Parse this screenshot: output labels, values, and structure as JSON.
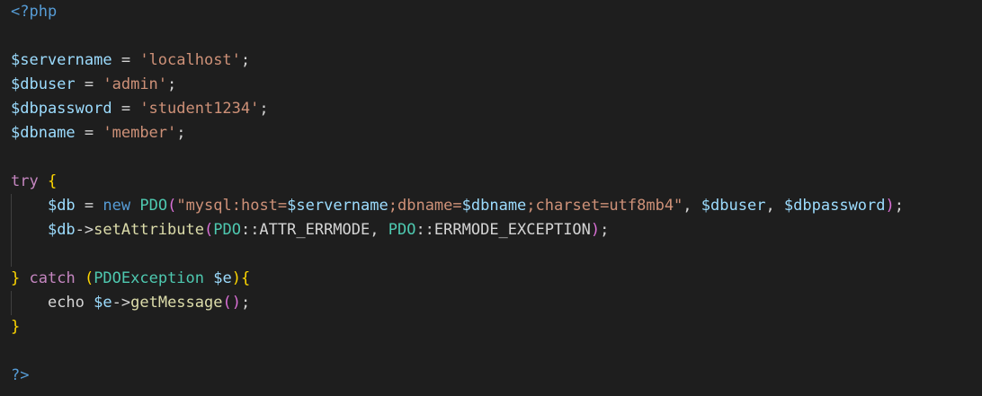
{
  "colors": {
    "background": "#1e1e1e",
    "default": "#d4d4d4",
    "php_tag": "#569cd6",
    "variable": "#9cdcfe",
    "string": "#ce9178",
    "keyword": "#c586c0",
    "storage": "#569cd6",
    "class": "#4ec9b0",
    "function": "#dcdcaa",
    "bracket_gold": "#ffd700",
    "bracket_purple": "#da70d6",
    "bracket_blue": "#179fff"
  },
  "lines": [
    {
      "indent": 0,
      "guide": false,
      "tokens": [
        {
          "t": "<?php",
          "c": "php_tag"
        }
      ]
    },
    {
      "indent": 0,
      "guide": false,
      "tokens": []
    },
    {
      "indent": 0,
      "guide": false,
      "tokens": [
        {
          "t": "$servername",
          "c": "variable"
        },
        {
          "t": " = ",
          "c": "default"
        },
        {
          "t": "'localhost'",
          "c": "string"
        },
        {
          "t": ";",
          "c": "default"
        }
      ]
    },
    {
      "indent": 0,
      "guide": false,
      "tokens": [
        {
          "t": "$dbuser",
          "c": "variable"
        },
        {
          "t": " = ",
          "c": "default"
        },
        {
          "t": "'admin'",
          "c": "string"
        },
        {
          "t": ";",
          "c": "default"
        }
      ]
    },
    {
      "indent": 0,
      "guide": false,
      "tokens": [
        {
          "t": "$dbpassword",
          "c": "variable"
        },
        {
          "t": " = ",
          "c": "default"
        },
        {
          "t": "'student1234'",
          "c": "string"
        },
        {
          "t": ";",
          "c": "default"
        }
      ]
    },
    {
      "indent": 0,
      "guide": false,
      "tokens": [
        {
          "t": "$dbname",
          "c": "variable"
        },
        {
          "t": " = ",
          "c": "default"
        },
        {
          "t": "'member'",
          "c": "string"
        },
        {
          "t": ";",
          "c": "default"
        }
      ]
    },
    {
      "indent": 0,
      "guide": false,
      "tokens": []
    },
    {
      "indent": 0,
      "guide": false,
      "tokens": [
        {
          "t": "try",
          "c": "keyword"
        },
        {
          "t": " ",
          "c": "default"
        },
        {
          "t": "{",
          "c": "bracket_gold"
        }
      ]
    },
    {
      "indent": 4,
      "guide": true,
      "tokens": [
        {
          "t": "$db",
          "c": "variable"
        },
        {
          "t": " = ",
          "c": "default"
        },
        {
          "t": "new",
          "c": "storage"
        },
        {
          "t": " ",
          "c": "default"
        },
        {
          "t": "PDO",
          "c": "class"
        },
        {
          "t": "(",
          "c": "bracket_purple"
        },
        {
          "t": "\"mysql:host=",
          "c": "string"
        },
        {
          "t": "$servername",
          "c": "variable"
        },
        {
          "t": ";dbname=",
          "c": "string"
        },
        {
          "t": "$dbname",
          "c": "variable"
        },
        {
          "t": ";charset=utf8mb4\"",
          "c": "string"
        },
        {
          "t": ", ",
          "c": "default"
        },
        {
          "t": "$dbuser",
          "c": "variable"
        },
        {
          "t": ", ",
          "c": "default"
        },
        {
          "t": "$dbpassword",
          "c": "variable"
        },
        {
          "t": ")",
          "c": "bracket_purple"
        },
        {
          "t": ";",
          "c": "default"
        }
      ]
    },
    {
      "indent": 4,
      "guide": true,
      "tokens": [
        {
          "t": "$db",
          "c": "variable"
        },
        {
          "t": "->",
          "c": "default"
        },
        {
          "t": "setAttribute",
          "c": "function"
        },
        {
          "t": "(",
          "c": "bracket_purple"
        },
        {
          "t": "PDO",
          "c": "class"
        },
        {
          "t": "::ATTR_ERRMODE, ",
          "c": "default"
        },
        {
          "t": "PDO",
          "c": "class"
        },
        {
          "t": "::ERRMODE_EXCEPTION",
          "c": "default"
        },
        {
          "t": ")",
          "c": "bracket_purple"
        },
        {
          "t": ";",
          "c": "default"
        }
      ]
    },
    {
      "indent": 0,
      "guide": true,
      "tokens": []
    },
    {
      "indent": 0,
      "guide": false,
      "tokens": [
        {
          "t": "}",
          "c": "bracket_gold"
        },
        {
          "t": " ",
          "c": "default"
        },
        {
          "t": "catch",
          "c": "keyword"
        },
        {
          "t": " ",
          "c": "default"
        },
        {
          "t": "(",
          "c": "bracket_gold"
        },
        {
          "t": "PDOException",
          "c": "class"
        },
        {
          "t": " ",
          "c": "default"
        },
        {
          "t": "$e",
          "c": "variable"
        },
        {
          "t": ")",
          "c": "bracket_gold"
        },
        {
          "t": "{",
          "c": "bracket_gold"
        }
      ]
    },
    {
      "indent": 4,
      "guide": true,
      "tokens": [
        {
          "t": "echo",
          "c": "default"
        },
        {
          "t": " ",
          "c": "default"
        },
        {
          "t": "$e",
          "c": "variable"
        },
        {
          "t": "->",
          "c": "default"
        },
        {
          "t": "getMessage",
          "c": "function"
        },
        {
          "t": "(",
          "c": "bracket_purple"
        },
        {
          "t": ")",
          "c": "bracket_purple"
        },
        {
          "t": ";",
          "c": "default"
        }
      ]
    },
    {
      "indent": 0,
      "guide": false,
      "tokens": [
        {
          "t": "}",
          "c": "bracket_gold"
        }
      ]
    },
    {
      "indent": 0,
      "guide": false,
      "tokens": []
    },
    {
      "indent": 0,
      "guide": false,
      "tokens": [
        {
          "t": "?>",
          "c": "php_tag"
        }
      ]
    }
  ]
}
